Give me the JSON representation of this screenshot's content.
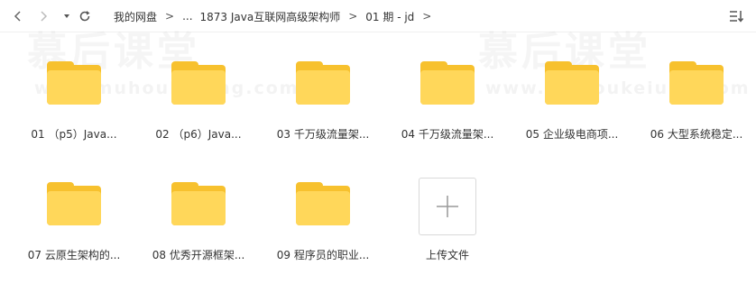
{
  "toolbar": {
    "back_icon": "chevron-left-icon",
    "forward_icon": "chevron-right-icon",
    "history_icon": "caret-down-icon",
    "refresh_icon": "refresh-icon",
    "sort_icon": "sort-icon"
  },
  "breadcrumb": {
    "separator": ">",
    "items": [
      {
        "label": "我的网盘"
      },
      {
        "label": "..."
      },
      {
        "label": "1873 Java互联网高级架构师"
      },
      {
        "label": "01 期 - jd"
      }
    ]
  },
  "watermark": {
    "title": "慕后课堂",
    "url": "www.muhoukeiung.com"
  },
  "folders": [
    {
      "label": "01 （p5）Java...",
      "icon": "folder-icon"
    },
    {
      "label": "02 （p6）Java...",
      "icon": "folder-icon"
    },
    {
      "label": "03 千万级流量架...",
      "icon": "folder-icon"
    },
    {
      "label": "04 千万级流量架...",
      "icon": "folder-icon"
    },
    {
      "label": "05 企业级电商项...",
      "icon": "folder-icon"
    },
    {
      "label": "06 大型系统稳定...",
      "icon": "folder-icon"
    },
    {
      "label": "07 云原生架构的...",
      "icon": "folder-icon"
    },
    {
      "label": "08 优秀开源框架...",
      "icon": "folder-icon"
    },
    {
      "label": "09 程序员的职业...",
      "icon": "folder-icon"
    }
  ],
  "upload": {
    "label": "上传文件",
    "icon": "plus-icon"
  },
  "colors": {
    "folder_front": "#ffd75a",
    "folder_back": "#f7c12e",
    "text": "#333333",
    "icon_gray": "#999999",
    "upload_border": "#d9d9d9"
  }
}
